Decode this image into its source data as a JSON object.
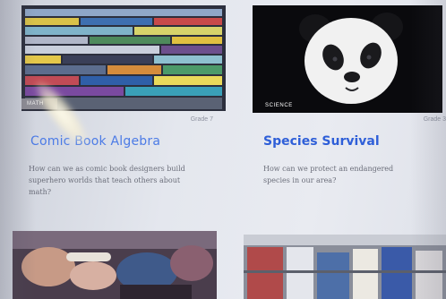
{
  "cards": [
    {
      "tag": "MATH",
      "grade": "Grade 7",
      "title": "Comic Book Algebra",
      "description": "How can we as comic book designers build superhero worlds that teach others about math?",
      "image": "comic-book-pages-photo"
    },
    {
      "tag": "SCIENCE",
      "grade": "Grade 3",
      "title": "Species Survival",
      "description": "How can we protect an endangered species in our area?",
      "image": "panda-photo"
    },
    {
      "image": "classroom-hands-photo"
    },
    {
      "image": "grocery-store-shelves-photo"
    }
  ],
  "colors": {
    "title_blue": "#3f6fe0",
    "body_text": "#6b6e7a",
    "grade_text": "#8f93a0"
  }
}
